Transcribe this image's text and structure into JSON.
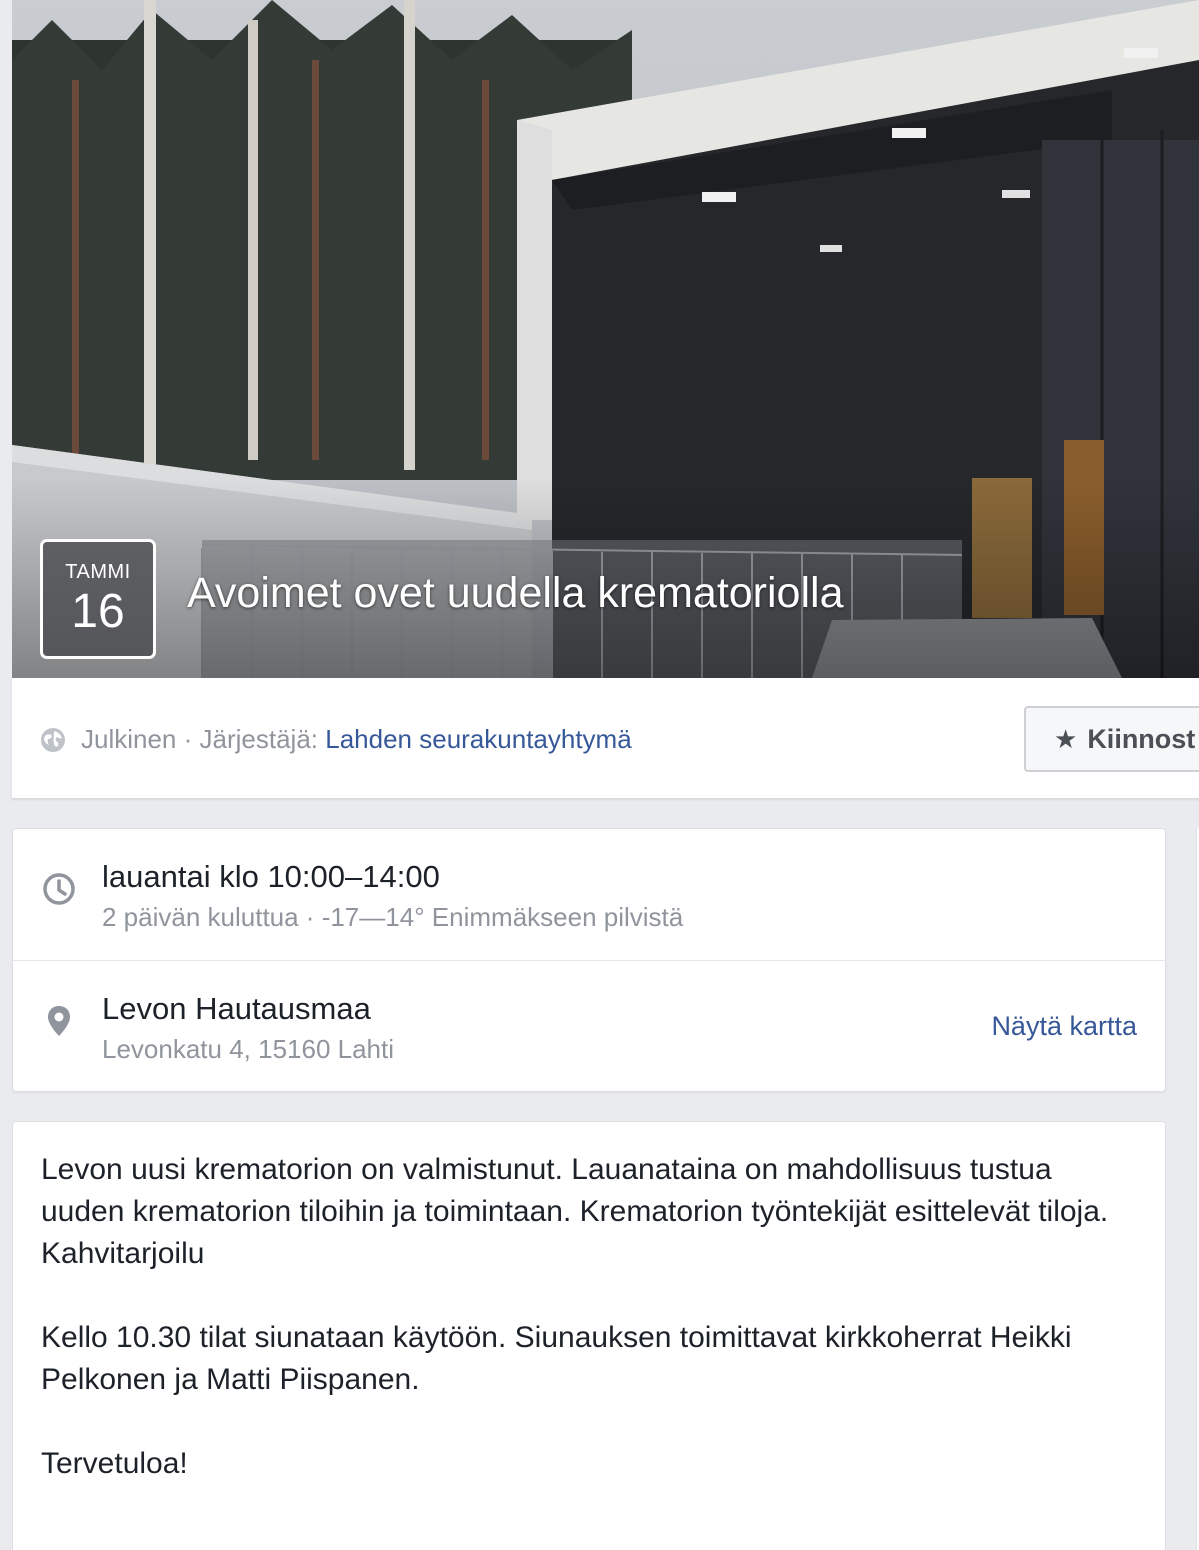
{
  "event": {
    "month": "TAMMI",
    "day": "16",
    "title": "Avoimet ovet uudella krematoriolla"
  },
  "meta": {
    "privacy": "Julkinen",
    "separator": " · ",
    "organizer_prefix": "Järjestäjä: ",
    "organizer_name": "Lahden seurakuntayhtymä",
    "interested_label": "Kiinnost",
    "icons": {
      "privacy": "globe-icon",
      "interested": "star-icon"
    }
  },
  "details": {
    "time": {
      "icon": "clock-icon",
      "primary": "lauantai klo 10:00–14:00",
      "secondary": "2 päivän kuluttua · -17—14° Enimmäkseen pilvistä"
    },
    "place": {
      "icon": "map-pin-icon",
      "primary": "Levon Hautausmaa",
      "secondary": "Levonkatu 4, 15160 Lahti",
      "map_link": "Näytä kartta"
    }
  },
  "description": {
    "p1": "Levon uusi krematorion on valmistunut. Lauanataina on mahdollisuus tustua uuden krematorion tiloihin ja toimintaan. Krematorion työntekijät esittelevät tiloja.",
    "p2": "Kahvitarjoilu",
    "p3": "Kello 10.30 tilat siunataan käytöön. Siunauksen toimittavat kirkkoherrat Heikki Pelkonen ja Matti Piispanen.",
    "p4": "Tervetuloa!"
  },
  "colors": {
    "link": "#365899",
    "muted": "#90949c",
    "text": "#1d2129",
    "background": "#e9ebee"
  }
}
